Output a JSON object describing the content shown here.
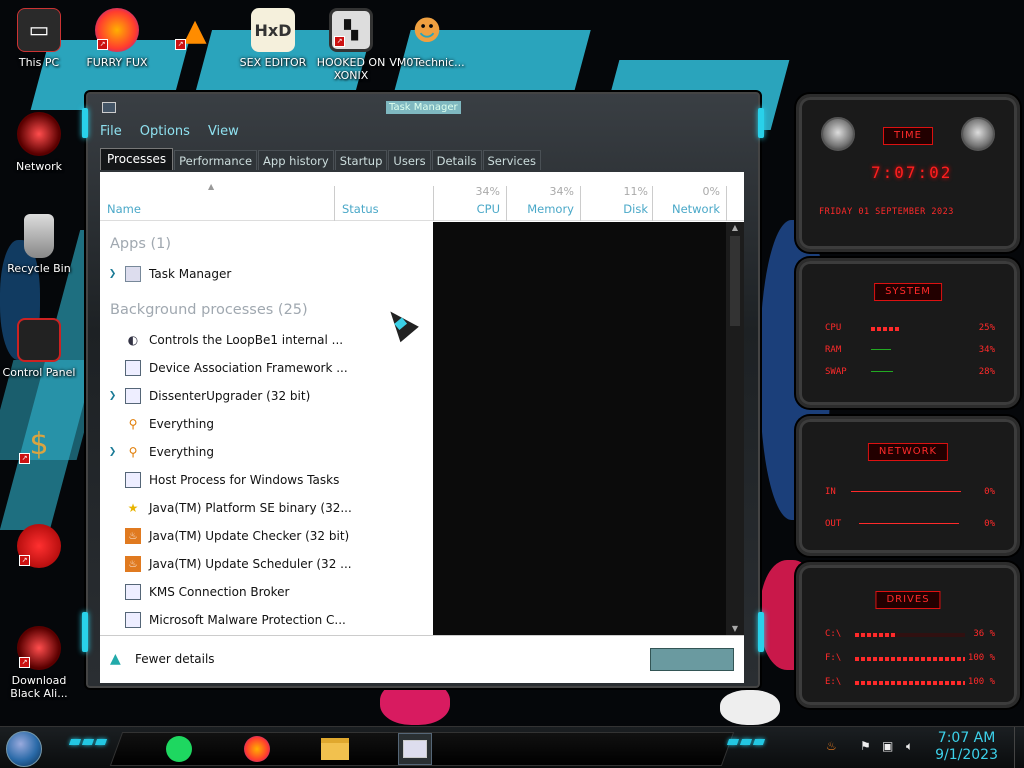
{
  "desktop": {
    "icons": [
      {
        "label": "This PC"
      },
      {
        "label": "FURRY FUX"
      },
      {
        "label": ""
      },
      {
        "label": "SEX EDITOR"
      },
      {
        "label": "HOOKED ON XONIX"
      },
      {
        "label": "VM0Technic..."
      },
      {
        "label": "Network"
      },
      {
        "label": "Recycle Bin"
      },
      {
        "label": "Control Panel"
      },
      {
        "label": ""
      },
      {
        "label": ""
      },
      {
        "label": "Download Black Ali..."
      }
    ]
  },
  "window": {
    "title": "Task Manager",
    "menu": [
      "File",
      "Options",
      "View"
    ],
    "tabs": [
      "Processes",
      "Performance",
      "App history",
      "Startup",
      "Users",
      "Details",
      "Services"
    ],
    "active_tab": "Processes",
    "columns": {
      "name": "Name",
      "status": "Status",
      "cpu_pct": "34%",
      "cpu": "CPU",
      "memory_pct": "34%",
      "memory": "Memory",
      "disk_pct": "11%",
      "disk": "Disk",
      "network_pct": "0%",
      "network": "Network"
    },
    "groups": {
      "apps": "Apps (1)",
      "background": "Background processes (25)"
    },
    "apps": [
      {
        "name": "Task Manager",
        "expandable": true,
        "icon": "task-manager-icon"
      }
    ],
    "background": [
      {
        "name": "Controls the LoopBe1 internal ...",
        "expandable": false,
        "icon": "loopbe-icon"
      },
      {
        "name": "Device Association Framework ...",
        "expandable": false,
        "icon": "window-app-icon"
      },
      {
        "name": "DissenterUpgrader (32 bit)",
        "expandable": true,
        "icon": "window-app-icon"
      },
      {
        "name": "Everything",
        "expandable": false,
        "icon": "magnifier-icon"
      },
      {
        "name": "Everything",
        "expandable": true,
        "icon": "magnifier-icon"
      },
      {
        "name": "Host Process for Windows Tasks",
        "expandable": false,
        "icon": "window-app-icon"
      },
      {
        "name": "Java(TM) Platform SE binary (32...",
        "expandable": false,
        "icon": "java-star-icon"
      },
      {
        "name": "Java(TM) Update Checker (32 bit)",
        "expandable": false,
        "icon": "java-icon"
      },
      {
        "name": "Java(TM) Update Scheduler (32 ...",
        "expandable": false,
        "icon": "java-icon"
      },
      {
        "name": "KMS Connection Broker",
        "expandable": false,
        "icon": "window-app-icon"
      },
      {
        "name": "Microsoft Malware Protection C...",
        "expandable": false,
        "icon": "window-app-icon"
      }
    ],
    "footer": {
      "fewer_details": "Fewer details",
      "end_task": ""
    }
  },
  "gadgets": {
    "time": {
      "title": "TIME",
      "clock": "7:07:02",
      "date": "FRIDAY 01 SEPTEMBER 2023"
    },
    "system": {
      "title": "SYSTEM",
      "rows": [
        {
          "label": "CPU",
          "value": "25%",
          "level": 0.25
        },
        {
          "label": "RAM",
          "value": "34%",
          "level": 0.34
        },
        {
          "label": "SWAP",
          "value": "28%",
          "level": 0.28
        }
      ]
    },
    "network": {
      "title": "NETWORK",
      "rows": [
        {
          "label": "IN",
          "value": "0%"
        },
        {
          "label": "OUT",
          "value": "0%"
        }
      ]
    },
    "drives": {
      "title": "DRIVES",
      "rows": [
        {
          "label": "C:\\",
          "value": "36 %",
          "level": 0.36
        },
        {
          "label": "F:\\",
          "value": "100 %",
          "level": 1.0
        },
        {
          "label": "E:\\",
          "value": "100 %",
          "level": 1.0
        }
      ]
    }
  },
  "taskbar": {
    "clock_time": "7:07 AM",
    "clock_date": "9/1/2023",
    "colors": {
      "accent": "#23c7e2",
      "gadget_red": "#ff2a2a"
    }
  }
}
